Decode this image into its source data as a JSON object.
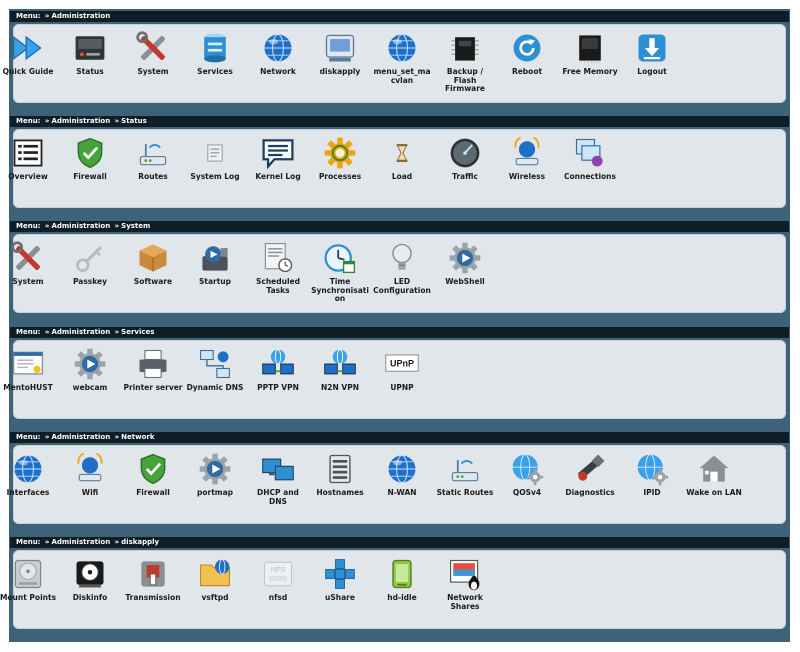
{
  "sections": [
    {
      "menu_prefix": "Menu:",
      "crumbs": [
        "Administration"
      ],
      "items": [
        {
          "label": "Quick Guide",
          "icon": "quick-guide-icon"
        },
        {
          "label": "Status",
          "icon": "status-icon"
        },
        {
          "label": "System",
          "icon": "tools-icon"
        },
        {
          "label": "Services",
          "icon": "services-icon"
        },
        {
          "label": "Network",
          "icon": "globe-icon"
        },
        {
          "label": "diskapply",
          "icon": "disk-icon"
        },
        {
          "label": "menu_set_macvlan",
          "icon": "globe-icon"
        },
        {
          "label": "Backup / Flash Firmware",
          "icon": "chip-icon"
        },
        {
          "label": "Reboot",
          "icon": "reboot-icon"
        },
        {
          "label": "Free Memory",
          "icon": "memory-icon"
        },
        {
          "label": "Logout",
          "icon": "logout-icon"
        }
      ]
    },
    {
      "menu_prefix": "Menu:",
      "crumbs": [
        "Administration",
        "Status"
      ],
      "items": [
        {
          "label": "Overview",
          "icon": "overview-icon"
        },
        {
          "label": "Firewall",
          "icon": "shield-icon"
        },
        {
          "label": "Routes",
          "icon": "router-icon"
        },
        {
          "label": "System Log",
          "icon": "log-icon"
        },
        {
          "label": "Kernel Log",
          "icon": "speech-bubble-icon"
        },
        {
          "label": "Processes",
          "icon": "gear-icon"
        },
        {
          "label": "Load",
          "icon": "hourglass-icon"
        },
        {
          "label": "Traffic",
          "icon": "gauge-icon"
        },
        {
          "label": "Wireless",
          "icon": "wireless-icon"
        },
        {
          "label": "Connections",
          "icon": "connections-icon"
        }
      ]
    },
    {
      "menu_prefix": "Menu:",
      "crumbs": [
        "Administration",
        "System"
      ],
      "items": [
        {
          "label": "System",
          "icon": "tools-icon"
        },
        {
          "label": "Passkey",
          "icon": "key-icon"
        },
        {
          "label": "Software",
          "icon": "box-icon"
        },
        {
          "label": "Startup",
          "icon": "startup-icon"
        },
        {
          "label": "Scheduled Tasks",
          "icon": "scheduled-tasks-icon"
        },
        {
          "label": "Time Synchronisation",
          "icon": "clock-icon"
        },
        {
          "label": "LED Configuration",
          "icon": "bulb-icon"
        },
        {
          "label": "WebShell",
          "icon": "play-gear-icon"
        }
      ]
    },
    {
      "menu_prefix": "Menu:",
      "crumbs": [
        "Administration",
        "Services"
      ],
      "items": [
        {
          "label": "MentoHUST",
          "icon": "certificate-icon"
        },
        {
          "label": "webcam",
          "icon": "play-gear-icon"
        },
        {
          "label": "Printer server",
          "icon": "printer-icon"
        },
        {
          "label": "Dynamic DNS",
          "icon": "dynamic-dns-icon"
        },
        {
          "label": "PPTP VPN",
          "icon": "vpn-icon"
        },
        {
          "label": "N2N VPN",
          "icon": "vpn-icon"
        },
        {
          "label": "UPNP",
          "icon": "upnp-icon",
          "badge": "UPnP"
        }
      ]
    },
    {
      "menu_prefix": "Menu:",
      "crumbs": [
        "Administration",
        "Network"
      ],
      "items": [
        {
          "label": "Interfaces",
          "icon": "globe-icon"
        },
        {
          "label": "Wifi",
          "icon": "wireless-icon"
        },
        {
          "label": "Firewall",
          "icon": "shield-icon"
        },
        {
          "label": "portmap",
          "icon": "play-gear-icon"
        },
        {
          "label": "DHCP and DNS",
          "icon": "monitors-icon"
        },
        {
          "label": "Hostnames",
          "icon": "server-icon"
        },
        {
          "label": "N-WAN",
          "icon": "globe-icon"
        },
        {
          "label": "Static Routes",
          "icon": "router-icon"
        },
        {
          "label": "QOSv4",
          "icon": "globe-gear-icon"
        },
        {
          "label": "Diagnostics",
          "icon": "diagnostics-icon"
        },
        {
          "label": "IPID",
          "icon": "globe-gear-icon"
        },
        {
          "label": "Wake on LAN",
          "icon": "house-icon"
        }
      ]
    },
    {
      "menu_prefix": "Menu:",
      "crumbs": [
        "Administration",
        "diskapply"
      ],
      "items": [
        {
          "label": "Mount Points",
          "icon": "hard-drive-icon"
        },
        {
          "label": "Diskinfo",
          "icon": "disk-info-icon"
        },
        {
          "label": "Transmission",
          "icon": "transmission-icon"
        },
        {
          "label": "vsftpd",
          "icon": "folder-globe-icon"
        },
        {
          "label": "nfsd",
          "icon": "nfs-icon",
          "badge": "NFS"
        },
        {
          "label": "uShare",
          "icon": "blocks-icon"
        },
        {
          "label": "hd-idle",
          "icon": "hd-idle-icon"
        },
        {
          "label": "Network Shares",
          "icon": "network-shares-icon"
        }
      ]
    }
  ],
  "colors": {
    "frame": "#3e6378",
    "header": "#0f1d27",
    "panel": "#e1e6ea",
    "globe": "#1f6fc8",
    "shield": "#45a33a",
    "gear": "#f2a20e"
  }
}
